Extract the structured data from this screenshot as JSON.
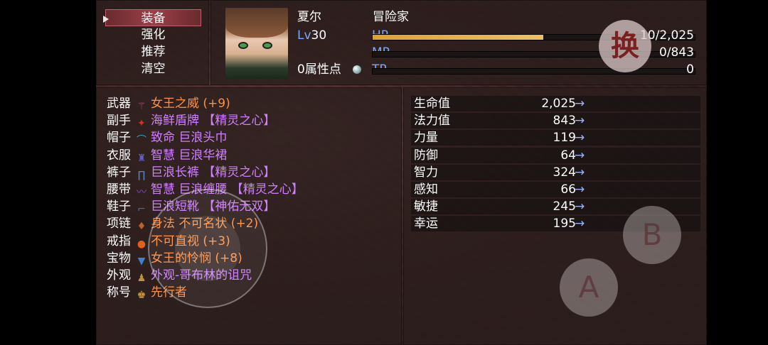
{
  "menu": {
    "commands": [
      "装备",
      "强化",
      "推荐",
      "清空"
    ],
    "selected_index": 0
  },
  "actor": {
    "name": "夏尔",
    "class": "冒险家",
    "level_label": "Lv",
    "level": "30",
    "attribute_points": "0属性点",
    "hp": {
      "label": "HP",
      "value": "10/2,025",
      "fill": 0.53
    },
    "mp": {
      "label": "MP",
      "value": "0/843",
      "fill": 0
    },
    "tp": {
      "label": "TP",
      "value": "0",
      "fill": 0
    }
  },
  "swap_button": {
    "label": "换"
  },
  "equipment": [
    {
      "slot": "武器",
      "icon": "wand-icon",
      "glyph": "⚚",
      "color": "#c04080",
      "item": "女王之威 (+9)",
      "rarity": "orange"
    },
    {
      "slot": "副手",
      "icon": "shield-icon",
      "glyph": "✦",
      "color": "#d03030",
      "item": "海鲜盾牌 【精灵之心】",
      "rarity": "purple"
    },
    {
      "slot": "帽子",
      "icon": "hat-icon",
      "glyph": "⌒",
      "color": "#40a0c0",
      "item": "致命 巨浪头巾",
      "rarity": "purple"
    },
    {
      "slot": "衣服",
      "icon": "clothes-icon",
      "glyph": "♜",
      "color": "#6060c0",
      "item": "智慧 巨浪华裙",
      "rarity": "purple"
    },
    {
      "slot": "裤子",
      "icon": "pants-icon",
      "glyph": "∏",
      "color": "#5080c0",
      "item": "巨浪长裤 【精灵之心】",
      "rarity": "purple"
    },
    {
      "slot": "腰带",
      "icon": "belt-icon",
      "glyph": "〰",
      "color": "#8050c0",
      "item": "智慧 巨浪缠腰 【精灵之心】",
      "rarity": "purple"
    },
    {
      "slot": "鞋子",
      "icon": "boots-icon",
      "glyph": "⌐",
      "color": "#4070b0",
      "item": "巨浪短靴 【神佑无双】",
      "rarity": "purple"
    },
    {
      "slot": "项链",
      "icon": "necklace-icon",
      "glyph": "♦",
      "color": "#c06030",
      "item": "身法 不可名状 (+2)",
      "rarity": "orange"
    },
    {
      "slot": "戒指",
      "icon": "ring-icon",
      "glyph": "●",
      "color": "#e06020",
      "item": "不可直视 (+3)",
      "rarity": "orange"
    },
    {
      "slot": "宝物",
      "icon": "treasure-icon",
      "glyph": "▼",
      "color": "#4080d0",
      "item": "女王的怜悯 (+8)",
      "rarity": "orange"
    },
    {
      "slot": "外观",
      "icon": "costume-icon",
      "glyph": "♟",
      "color": "#c09040",
      "item": "外观-哥布林的诅咒",
      "rarity": "purple"
    },
    {
      "slot": "称号",
      "icon": "title-icon",
      "glyph": "♚",
      "color": "#d0a040",
      "item": "先行者",
      "rarity": "orange"
    }
  ],
  "stats": [
    {
      "name": "生命值",
      "value": "2,025",
      "arrow": "→"
    },
    {
      "name": "法力值",
      "value": "843",
      "arrow": "→"
    },
    {
      "name": "力量",
      "value": "119",
      "arrow": "→"
    },
    {
      "name": "防御",
      "value": "64",
      "arrow": "→"
    },
    {
      "name": "智力",
      "value": "324",
      "arrow": "→"
    },
    {
      "name": "感知",
      "value": "66",
      "arrow": "→"
    },
    {
      "name": "敏捷",
      "value": "245",
      "arrow": "→"
    },
    {
      "name": "幸运",
      "value": "195",
      "arrow": "→"
    }
  ],
  "virtual_buttons": {
    "a": "A",
    "b": "B"
  },
  "colors": {
    "item_orange": "#ff9040",
    "item_purple": "#d080ff",
    "label_blue": "#7aa8ff",
    "hp_bar": "#e0a030"
  }
}
